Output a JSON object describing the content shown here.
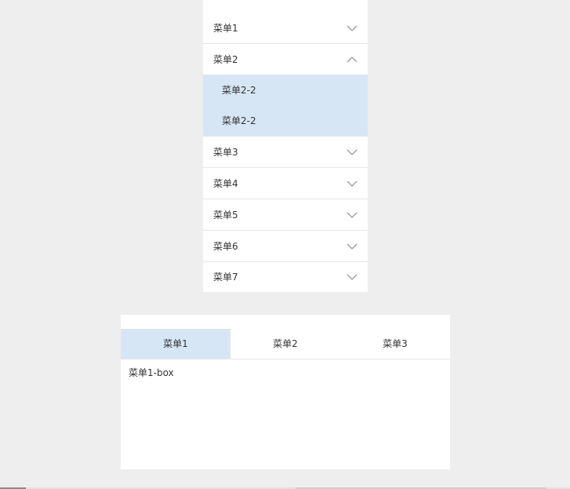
{
  "accordion": {
    "items": [
      {
        "label": "菜单1",
        "expanded": false
      },
      {
        "label": "菜单2",
        "expanded": true,
        "children": [
          "菜单2-2",
          "菜单2-2"
        ]
      },
      {
        "label": "菜单3",
        "expanded": false
      },
      {
        "label": "菜单4",
        "expanded": false
      },
      {
        "label": "菜单5",
        "expanded": false
      },
      {
        "label": "菜单6",
        "expanded": false
      },
      {
        "label": "菜单7",
        "expanded": false
      }
    ],
    "icons": {
      "collapsed": "chevron-down-icon",
      "expanded": "chevron-up-icon"
    },
    "colors": {
      "active_bg": "#d6e6f5",
      "chevron": "#999999"
    }
  },
  "tabs": {
    "items": [
      "菜单1",
      "菜单2",
      "菜单3"
    ],
    "active_index": 0,
    "content": "菜单1-box"
  },
  "colors": {
    "page_bg": "#eeeeee",
    "panel_bg": "#ffffff",
    "highlight": "#d6e6f5",
    "text": "#333333",
    "divider": "#e6e6e6"
  }
}
